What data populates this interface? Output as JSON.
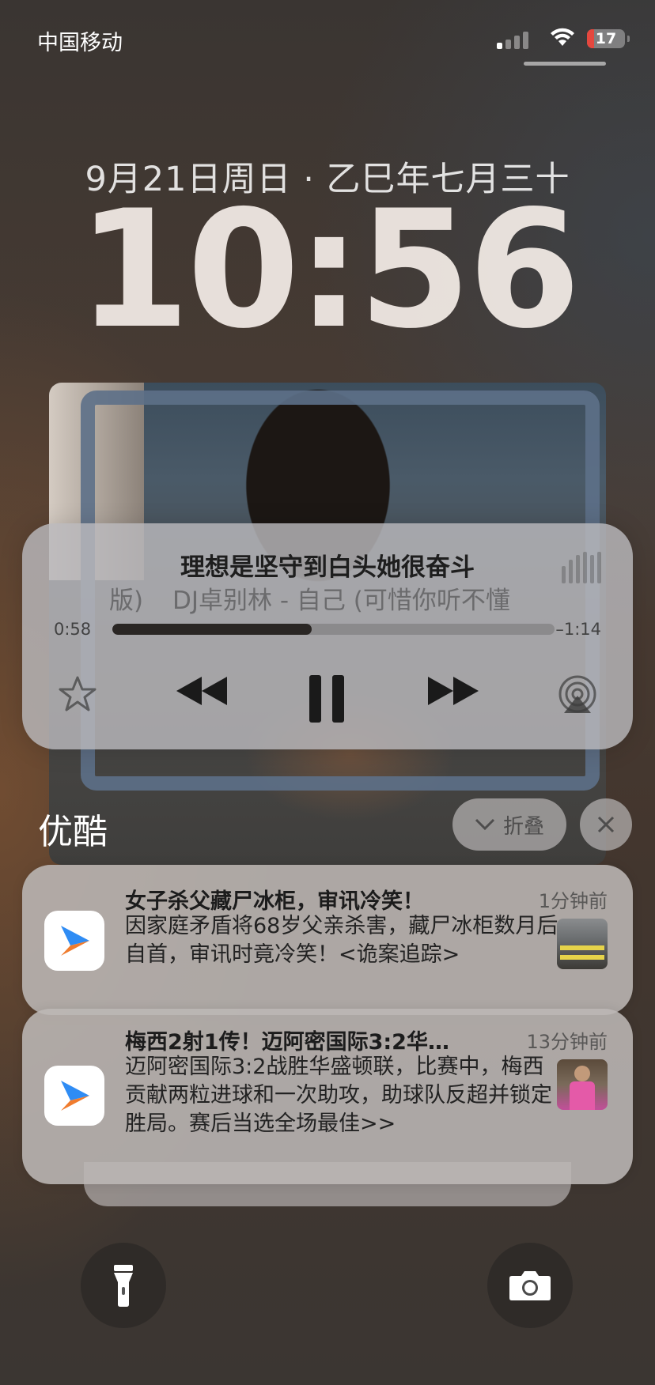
{
  "status_bar": {
    "carrier": "中国移动",
    "battery_level": "17",
    "battery_color": "#e5473e"
  },
  "lock_screen": {
    "date": "9月21日周日 · 乙巳年七月三十",
    "time": "10:56"
  },
  "now_playing": {
    "title": "理想是坚守到白头她很奋斗",
    "artist_prev_fragment": "版)",
    "artist_line": "DJ卓别林 - 自己 (可惜你听不懂",
    "elapsed": "0:58",
    "remaining": "–1:14",
    "progress_fraction": 0.45,
    "icons": {
      "favorite": "star-icon",
      "previous": "rewind-icon",
      "pause": "pause-icon",
      "next": "fast-forward-icon",
      "output": "airplay-icon",
      "visualizer": "audio-bars-icon"
    }
  },
  "notification_group": {
    "app_name": "优酷",
    "fold_label": "折叠",
    "notifications": [
      {
        "title": "女子杀父藏尸冰柜，审讯冷笑！",
        "body": "因家庭矛盾将68岁父亲杀害，藏尸冰柜数月后自首，审讯时竟冷笑！<诡案追踪>",
        "time": "1分钟前"
      },
      {
        "title": "梅西2射1传！迈阿密国际3:2华…",
        "body": "迈阿密国际3:2战胜华盛顿联，比赛中，梅西贡献两粒进球和一次助攻，助球队反超并锁定胜局。赛后当选全场最佳>>",
        "time": "13分钟前"
      }
    ]
  },
  "bottom_controls": {
    "left": "flashlight-icon",
    "right": "camera-icon"
  }
}
